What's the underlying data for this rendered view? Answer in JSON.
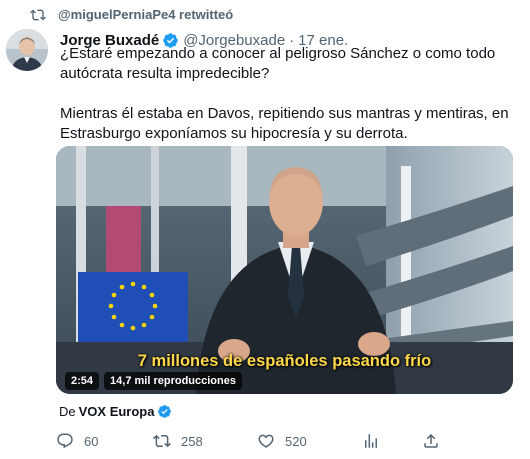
{
  "retweet_banner": {
    "text": "@miguelPerniaPe4 retwitteó",
    "icon": "retweet-icon"
  },
  "tweet": {
    "author_name": "Jorge Buxadé",
    "author_handle": "@Jorgebuxade",
    "separator": "·",
    "date": "17 ene.",
    "verified_color": "#1d9bf0",
    "text_p1": "¿Estaré empezando a conocer al peligroso Sánchez o como todo autócrata resulta impredecible?",
    "text_p2": "Mientras él estaba en Davos, repitiendo sus mantras y mentiras, en Estrasburgo exponíamos su hipocresía y su derrota."
  },
  "video": {
    "subtitle": "7 millones de españoles pasando frío",
    "duration": "2:54",
    "views": "14,7 mil reproducciones",
    "subtitle_color": "#ffd84a"
  },
  "source": {
    "prefix": "De",
    "name": "VOX Europa"
  },
  "actions": {
    "replies": "60",
    "retweets": "258",
    "likes": "520",
    "reply_icon": "reply-icon",
    "retweet_icon": "retweet-icon",
    "like_icon": "heart-icon",
    "stats_icon": "analytics-icon",
    "share_icon": "share-icon"
  }
}
